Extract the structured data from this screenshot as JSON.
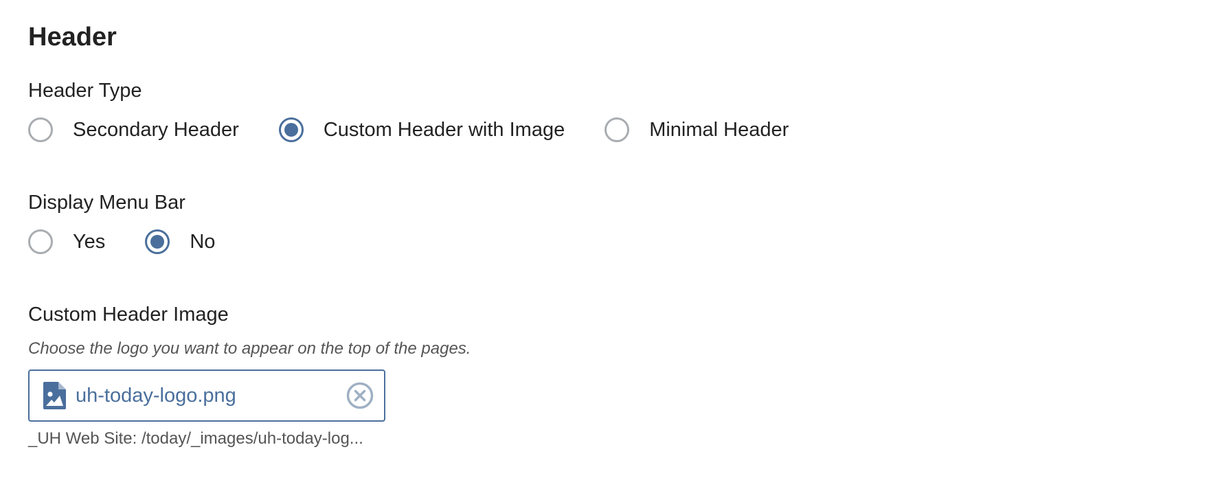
{
  "section": {
    "title": "Header"
  },
  "header_type": {
    "label": "Header Type",
    "options": [
      {
        "label": "Secondary Header",
        "checked": false
      },
      {
        "label": "Custom Header with Image",
        "checked": true
      },
      {
        "label": "Minimal Header",
        "checked": false
      }
    ]
  },
  "menu_bar": {
    "label": "Display Menu Bar",
    "options": [
      {
        "label": "Yes",
        "checked": false
      },
      {
        "label": "No",
        "checked": true
      }
    ]
  },
  "header_image": {
    "label": "Custom Header Image",
    "help": "Choose the logo you want to appear on the top of the pages.",
    "file_name": "uh-today-logo.png",
    "file_icon": "image-file-icon",
    "remove_icon": "close-circle-icon",
    "path": "_UH Web Site: /today/_images/uh-today-log..."
  },
  "colors": {
    "accent": "#4a6f9c",
    "radio_border": "#a9acb0",
    "text": "#222222",
    "muted": "#555555",
    "remove_icon": "#9fb0c3"
  }
}
